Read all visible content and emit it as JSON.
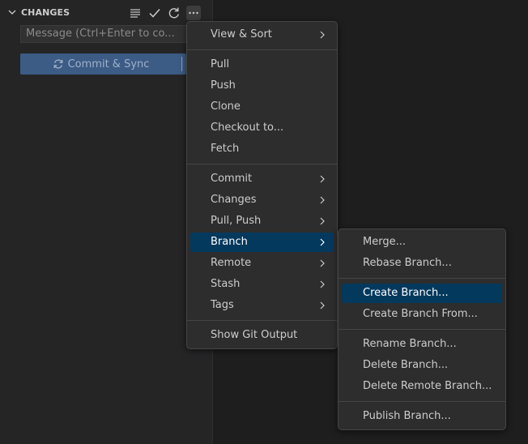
{
  "scm": {
    "section_title": "CHANGES",
    "header_icons": [
      "view-as-tree-icon",
      "commit-check-icon",
      "refresh-icon",
      "more-actions-icon"
    ],
    "message_placeholder": "Message (Ctrl+Enter to co...",
    "commit_button_label": "Commit & Sync"
  },
  "main_menu": {
    "groups": [
      [
        {
          "label": "View & Sort",
          "submenu": true
        }
      ],
      [
        {
          "label": "Pull",
          "submenu": false
        },
        {
          "label": "Push",
          "submenu": false
        },
        {
          "label": "Clone",
          "submenu": false
        },
        {
          "label": "Checkout to...",
          "submenu": false
        },
        {
          "label": "Fetch",
          "submenu": false
        }
      ],
      [
        {
          "label": "Commit",
          "submenu": true
        },
        {
          "label": "Changes",
          "submenu": true
        },
        {
          "label": "Pull, Push",
          "submenu": true
        },
        {
          "label": "Branch",
          "submenu": true,
          "active": true
        },
        {
          "label": "Remote",
          "submenu": true
        },
        {
          "label": "Stash",
          "submenu": true
        },
        {
          "label": "Tags",
          "submenu": true
        }
      ],
      [
        {
          "label": "Show Git Output",
          "submenu": false
        }
      ]
    ]
  },
  "branch_menu": {
    "groups": [
      [
        {
          "label": "Merge..."
        },
        {
          "label": "Rebase Branch..."
        }
      ],
      [
        {
          "label": "Create Branch...",
          "active": true
        },
        {
          "label": "Create Branch From..."
        }
      ],
      [
        {
          "label": "Rename Branch..."
        },
        {
          "label": "Delete Branch..."
        },
        {
          "label": "Delete Remote Branch..."
        }
      ],
      [
        {
          "label": "Publish Branch..."
        }
      ]
    ]
  },
  "colors": {
    "background": "#1e1e1e",
    "sidebar": "#252526",
    "menu_background": "#2d2d2d",
    "active_item": "#04395e",
    "commit_button": "#3c5b85"
  }
}
